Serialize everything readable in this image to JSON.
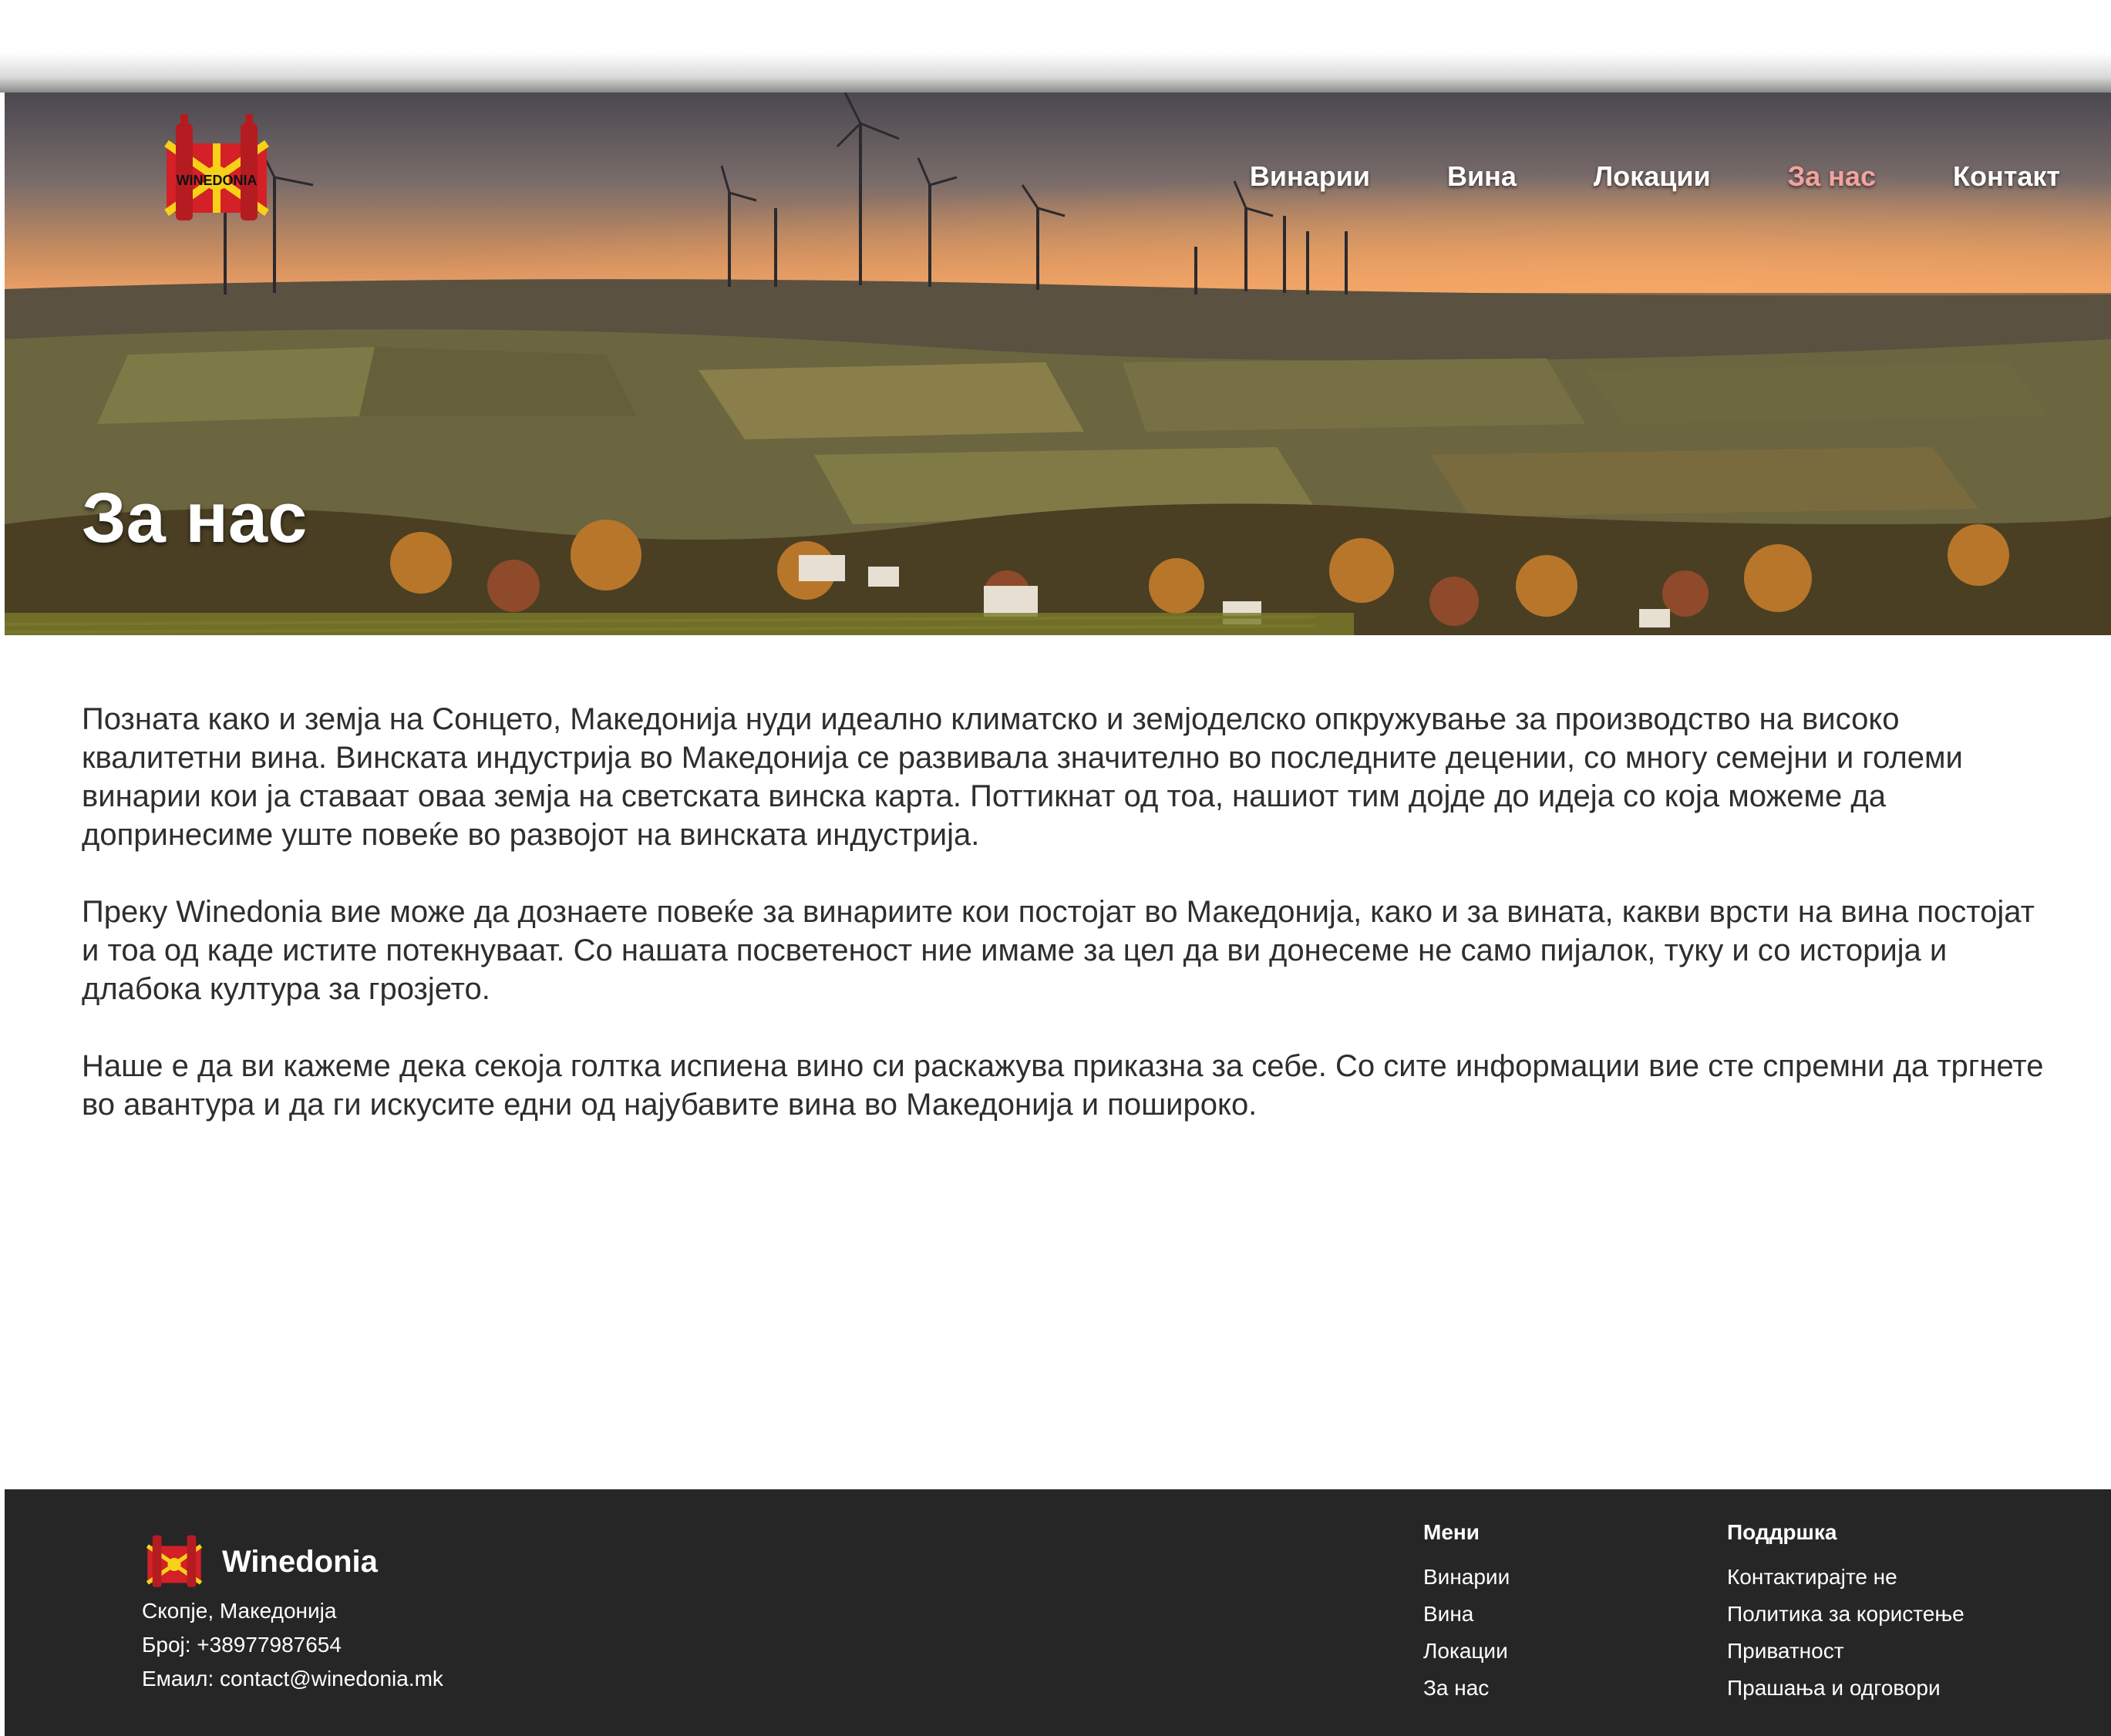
{
  "header": {
    "brand_logo_text": "WINEDONIA",
    "nav": [
      {
        "label": "Винарии",
        "active": false
      },
      {
        "label": "Вина",
        "active": false
      },
      {
        "label": "Локации",
        "active": false
      },
      {
        "label": "За нас",
        "active": true
      },
      {
        "label": "Контакт",
        "active": false
      }
    ],
    "accent_active_color": "#f2a3a0"
  },
  "hero": {
    "title": "За нас",
    "image": "sunset-landscape-with-wind-turbines-vineyards-and-village"
  },
  "content": {
    "paragraphs": [
      "Позната како и земја на Сонцето, Македонија нуди идеално климатско и земјоделско опкружување за производство на високо квалитетни вина. Винската индустрија во Македонија се развивала значително во последните децении, со многу семејни и големи винарии кои ја ставаат оваа земја на светската винска карта. Поттикнат од тоа, нашиот тим дојде до идеја со која можеме да допринесиме уште повеќе во развојот на винската индустрија.",
      "Преку Winedonia вие може да дознаете повеќе за винариите кои постојат во Македонија, како и за вината, какви врсти на вина постојат и тоа од каде истите потекнуваат. Со нашата посветеност ние имаме за цел да ви донесеме не само пијалок, туку и со историја и длабока култура за грозјето.",
      "Наше е да ви кажеме дека секоја голтка испиена вино си раскажува приказна за себе. Со сите информации вие сте спремни да тргнете во авантура и да ги искусите едни од најубавите вина во Македонија и пошироко."
    ]
  },
  "footer": {
    "brand": "Winedonia",
    "address": "Скопје, Македонија",
    "phone": "Број: +38977987654",
    "email": "Емаил: contact@winedonia.mk",
    "menu_heading": "Мени",
    "menu": [
      "Винарии",
      "Вина",
      "Локации",
      "За нас"
    ],
    "support_heading": "Поддршка",
    "support": [
      "Контактирајте не",
      "Политика за користење",
      "Приватност",
      "Прашања и одговори"
    ],
    "background_color": "#262626"
  }
}
